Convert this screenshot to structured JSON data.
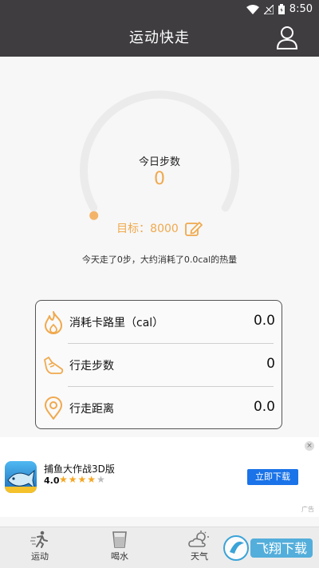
{
  "status_bar": {
    "time": "8:50",
    "icons": [
      "wifi-icon",
      "signal-icon",
      "battery-icon"
    ]
  },
  "app_bar": {
    "title": "运动快走",
    "profile_icon": "user-icon"
  },
  "today": {
    "title": "今日步数",
    "steps": "0",
    "goal_label": "目标：8000",
    "summary": "今天走了0步，大约消耗了0.0cal的热量",
    "progress_fraction": 0
  },
  "stats": [
    {
      "icon": "flame-icon",
      "label": "消耗卡路里（cal）",
      "value": "0.0"
    },
    {
      "icon": "shoe-icon",
      "label": "行走步数",
      "value": "0"
    },
    {
      "icon": "location-pin-icon",
      "label": "行走距离",
      "value": "0.0"
    }
  ],
  "ad": {
    "app_name": "捕鱼大作战3D版",
    "rating": "4.0",
    "stars_filled": 4,
    "stars_total": 5,
    "button": "立即下载",
    "close": "×",
    "tag": "广告"
  },
  "bottom_nav": [
    {
      "icon": "run-icon",
      "label": "运动"
    },
    {
      "icon": "cup-icon",
      "label": "喝水"
    },
    {
      "icon": "weather-icon",
      "label": "天气"
    }
  ],
  "watermark": "飞翔下载",
  "colors": {
    "header": "#3f3d40",
    "accent": "#f0a94e",
    "button_blue": "#1a73e8"
  }
}
